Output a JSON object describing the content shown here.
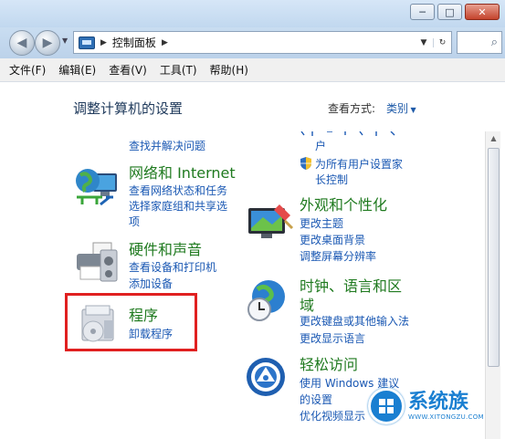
{
  "window": {
    "controls": {
      "minimize": "─",
      "maximize": "□",
      "close": "✕"
    }
  },
  "nav": {
    "back_icon": "back-arrow-icon",
    "forward_icon": "forward-arrow-icon",
    "address_icon": "control-panel-icon",
    "address_path": "控制面板",
    "dropdown_glyph": "▼",
    "refresh_glyph": "↻",
    "search_glyph": "⌕"
  },
  "menu": [
    "文件(F)",
    "编辑(E)",
    "查看(V)",
    "工具(T)",
    "帮助(H)"
  ],
  "page": {
    "title": "调整计算机的设置",
    "view_by_label": "查看方式:",
    "view_by_value": "类别"
  },
  "left": {
    "top_link": "查找并解决问题",
    "network": {
      "title": "网络和 Internet",
      "links": [
        "查看网络状态和任务",
        "选择家庭组和共享选",
        "项"
      ]
    },
    "hardware": {
      "title": "硬件和声音",
      "links": [
        "查看设备和打印机",
        "添加设备"
      ]
    },
    "programs": {
      "title": "程序",
      "links": [
        "卸载程序"
      ]
    }
  },
  "right": {
    "top_clipped": "户",
    "parental": {
      "links": [
        "为所有用户设置家",
        "长控制"
      ]
    },
    "appearance": {
      "title": "外观和个性化",
      "links": [
        "更改主题",
        "更改桌面背景",
        "调整屏幕分辨率"
      ]
    },
    "clock": {
      "title_line1": "时钟、语言和区",
      "title_line2": "域",
      "links": [
        "更改键盘或其他输入法",
        "更改显示语言"
      ]
    },
    "ease": {
      "title": "轻松访问",
      "links": [
        "使用 Windows 建议",
        "的设置",
        "优化视频显示"
      ]
    }
  },
  "watermark": {
    "main": "系统族",
    "sub": "WWW.XITONGZU.COM"
  },
  "colors": {
    "link": "#1a58b3",
    "category": "#1f7a1f",
    "highlight": "#e02020"
  }
}
